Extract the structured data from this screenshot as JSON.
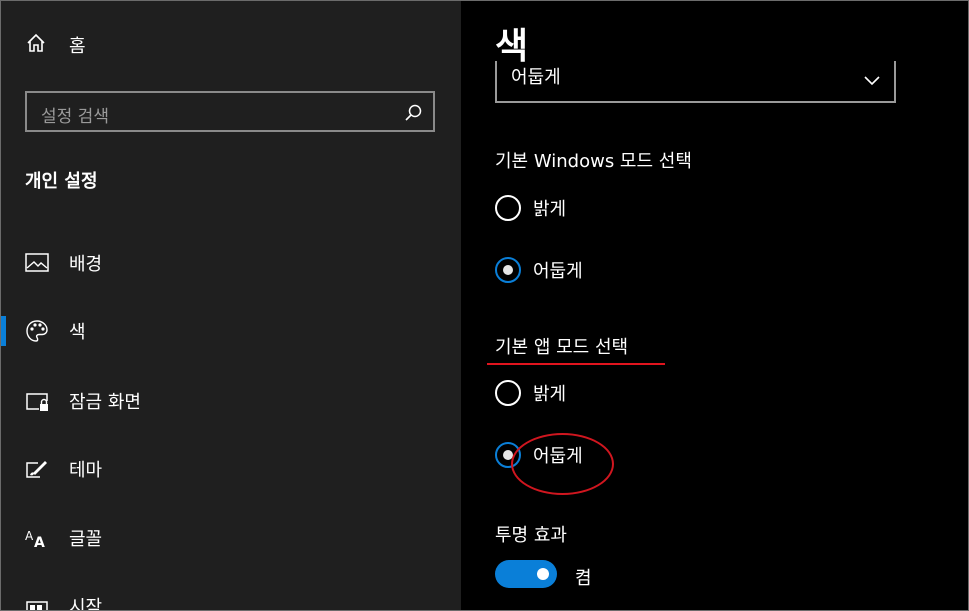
{
  "sidebar": {
    "home_label": "홈",
    "search_placeholder": "설정 검색",
    "section_title": "개인 설정",
    "items": [
      {
        "label": "배경",
        "icon": "picture-icon"
      },
      {
        "label": "색",
        "icon": "palette-icon",
        "selected": true
      },
      {
        "label": "잠금 화면",
        "icon": "lock-screen-icon"
      },
      {
        "label": "테마",
        "icon": "theme-brush-icon"
      },
      {
        "label": "글꼴",
        "icon": "font-icon"
      },
      {
        "label": "시작",
        "icon": "start-icon"
      }
    ]
  },
  "main": {
    "title": "색",
    "dropdown_value": "어둡게",
    "windows_mode": {
      "heading": "기본 Windows 모드 선택",
      "options": [
        "밝게",
        "어둡게"
      ],
      "selected": "어둡게"
    },
    "app_mode": {
      "heading": "기본 앱 모드 선택",
      "options": [
        "밝게",
        "어둡게"
      ],
      "selected": "어둡게"
    },
    "transparency": {
      "heading": "투명 효과",
      "state_label": "켬",
      "on": true
    }
  },
  "colors": {
    "accent": "#0a7fd8",
    "annotation": "#d0161f",
    "sidebar_bg": "#1f1f1f",
    "main_bg": "#000000"
  }
}
